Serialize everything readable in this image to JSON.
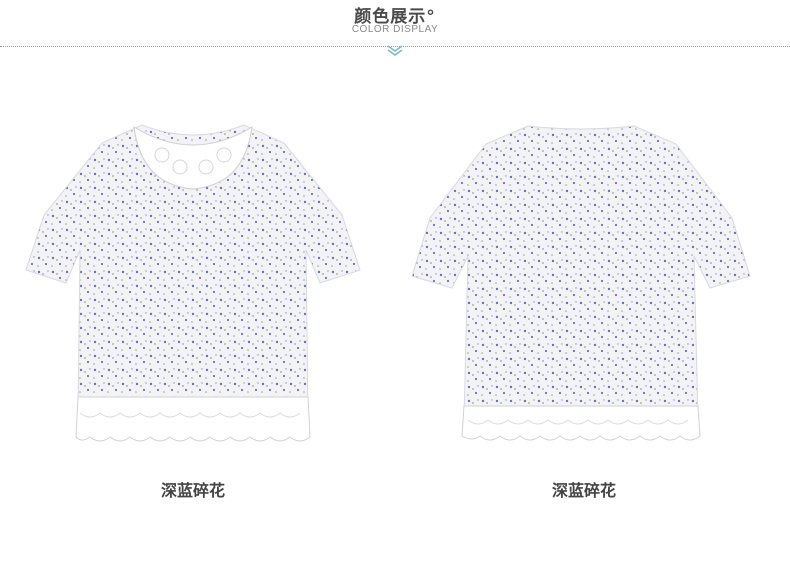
{
  "header": {
    "title": "颜色展示°",
    "subtitle": "COLOR DISPLAY",
    "chevron_icon": "double-chevron-down-icon"
  },
  "colors": {
    "fabric": "#f3f3f7",
    "print_blue": "#6a6fb8",
    "print_green": "#9aa87a",
    "lace": "#ffffff",
    "title_text": "#4a4a4a",
    "divider": "#9a9a9a"
  },
  "products": [
    {
      "view": "front",
      "caption": "深蓝碎花"
    },
    {
      "view": "back",
      "caption": "深蓝碎花"
    }
  ]
}
